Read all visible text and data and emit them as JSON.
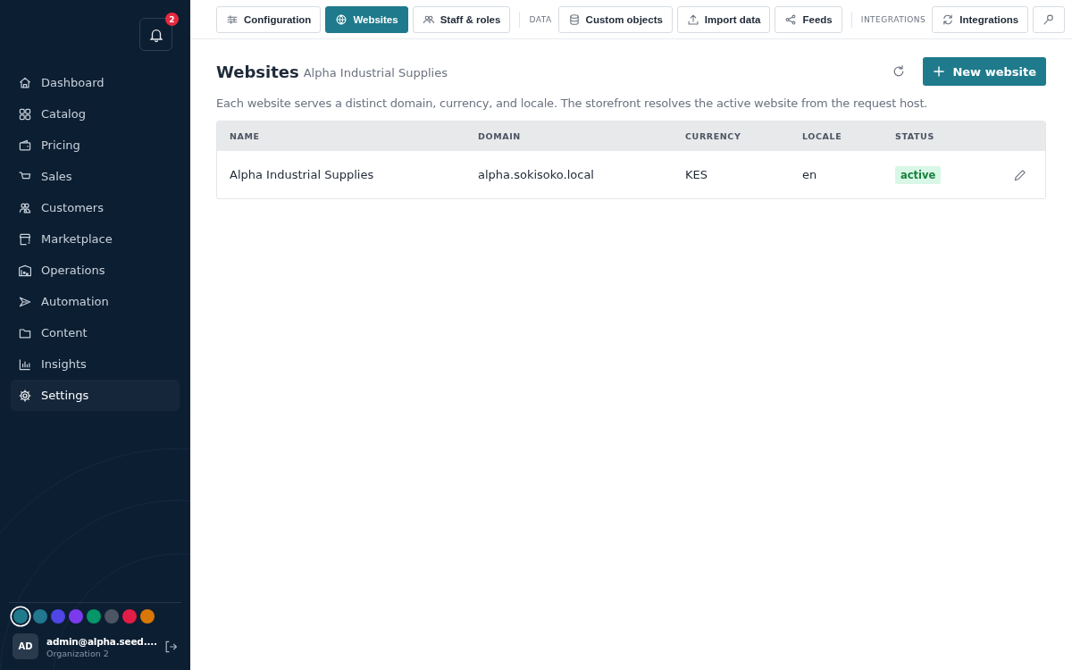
{
  "sidebar": {
    "notifications": {
      "count": "2"
    },
    "items": [
      {
        "label": "Dashboard",
        "selected": false
      },
      {
        "label": "Catalog",
        "selected": false
      },
      {
        "label": "Pricing",
        "selected": false
      },
      {
        "label": "Sales",
        "selected": false
      },
      {
        "label": "Customers",
        "selected": false
      },
      {
        "label": "Marketplace",
        "selected": false
      },
      {
        "label": "Operations",
        "selected": false
      },
      {
        "label": "Automation",
        "selected": false
      },
      {
        "label": "Content",
        "selected": false
      },
      {
        "label": "Insights",
        "selected": false
      },
      {
        "label": "Settings",
        "selected": true
      }
    ],
    "swatches": [
      {
        "color": "#1f7a8c",
        "selected": true
      },
      {
        "color": "#21788f",
        "selected": false
      },
      {
        "color": "#4f46e5",
        "selected": false
      },
      {
        "color": "#7c3aed",
        "selected": false
      },
      {
        "color": "#059669",
        "selected": false
      },
      {
        "color": "#4b5563",
        "selected": false
      },
      {
        "color": "#e11d48",
        "selected": false
      },
      {
        "color": "#d97706",
        "selected": false
      }
    ],
    "user": {
      "initials": "AD",
      "email": "admin@alpha.seed....",
      "organization": "Organization 2"
    }
  },
  "toolbar": [
    {
      "kind": "button",
      "label": "Configuration",
      "selected": false
    },
    {
      "kind": "button",
      "label": "Websites",
      "selected": true
    },
    {
      "kind": "button",
      "label": "Staff & roles",
      "selected": false
    },
    {
      "kind": "section",
      "label": "DATA"
    },
    {
      "kind": "button",
      "label": "Custom objects",
      "selected": false
    },
    {
      "kind": "button",
      "label": "Import data",
      "selected": false
    },
    {
      "kind": "button",
      "label": "Feeds",
      "selected": false
    },
    {
      "kind": "section",
      "label": "INTEGRATIONS"
    },
    {
      "kind": "button",
      "label": "Integrations",
      "selected": false
    },
    {
      "kind": "button",
      "selected": false
    }
  ],
  "page": {
    "title": "Websites",
    "subtitle": "Alpha Industrial Supplies",
    "primary_action": "New website",
    "description": "Each website serves a distinct domain, currency, and locale. The storefront resolves the active website from the request host."
  },
  "table": {
    "columns": [
      "NAME",
      "DOMAIN",
      "CURRENCY",
      "LOCALE",
      "STATUS"
    ],
    "rows": [
      {
        "name": "Alpha Industrial Supplies",
        "domain": "alpha.sokisoko.local",
        "currency": "KES",
        "locale": "en",
        "status": {
          "label": "active",
          "kind": "active"
        }
      }
    ]
  }
}
